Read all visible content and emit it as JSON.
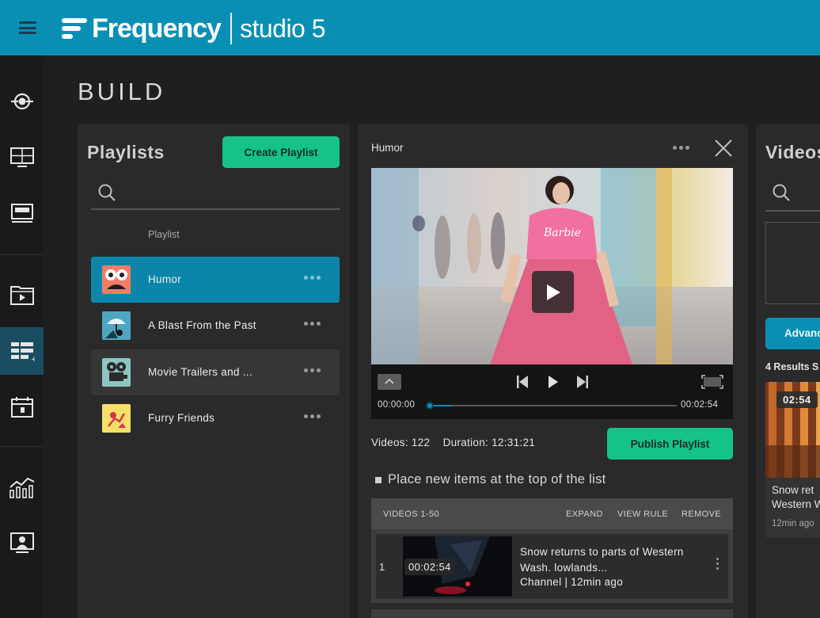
{
  "app": {
    "brand_name": "Frequency",
    "brand_sub": "studio 5"
  },
  "page": {
    "title": "BUILD"
  },
  "playlists_panel": {
    "title": "Playlists",
    "create_button": "Create Playlist",
    "search_placeholder": "",
    "column_header": "Playlist",
    "items": [
      {
        "name": "Humor",
        "state": "selected"
      },
      {
        "name": "A Blast From the Past",
        "state": "normal"
      },
      {
        "name": "Movie Trailers and ...",
        "state": "hover"
      },
      {
        "name": "Furry Friends",
        "state": "normal"
      }
    ]
  },
  "playlist_detail": {
    "title": "Humor",
    "player": {
      "current_time": "00:00:00",
      "total_time": "00:02:54",
      "progress": 0.0
    },
    "stats_videos": "Videos: 122",
    "stats_duration": "Duration: 12:31:21",
    "publish_button": "Publish Playlist",
    "option_top_of_list": "Place new items at the top of the list",
    "table": {
      "range_label": "VIDEOS 1-50",
      "expand": "EXPAND",
      "view_rule": "VIEW RULE",
      "remove": "REMOVE",
      "rows": [
        {
          "index": "1",
          "duration": "00:02:54",
          "title": "Snow returns to parts of Western Wash. lowlands...",
          "meta": "Channel | 12min ago"
        }
      ]
    }
  },
  "videos_panel": {
    "title": "Videos",
    "search_placeholder": "",
    "advanced_button": "Advanced",
    "results_label": "4 Results S",
    "card": {
      "duration": "02:54",
      "title_line1": "Snow ret",
      "title_line2": "Western W",
      "time": "12min ago"
    }
  },
  "colors": {
    "brand_blue": "#0a8fb4",
    "action_green": "#15c38a",
    "panel_bg": "#2a2a2a",
    "page_bg": "#1f1f1f"
  },
  "icons": {
    "rail": [
      "broadcast-icon",
      "dashboard-grid-icon",
      "tv-screen-icon",
      "video-folder-icon",
      "playlist-build-icon",
      "calendar-icon",
      "analytics-chart-icon",
      "user-profile-icon"
    ]
  }
}
